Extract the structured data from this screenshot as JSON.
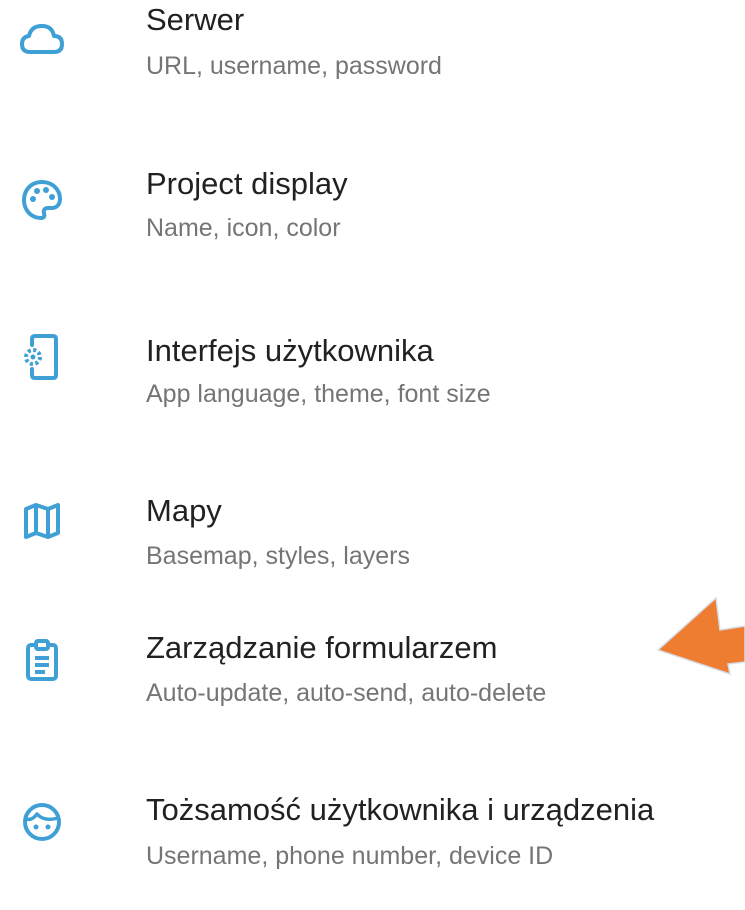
{
  "accent_color": "#3fa0d6",
  "annotation_color": "#ee7d31",
  "settings": [
    {
      "icon": "cloud-icon",
      "title": "Serwer",
      "subtitle": "URL, username, password"
    },
    {
      "icon": "palette-icon",
      "title": "Project display",
      "subtitle": "Name, icon, color"
    },
    {
      "icon": "phone-settings-icon",
      "title": "Interfejs użytkownika",
      "subtitle": "App language, theme, font size"
    },
    {
      "icon": "map-icon",
      "title": "Mapy",
      "subtitle": "Basemap, styles, layers"
    },
    {
      "icon": "clipboard-icon",
      "title": "Zarządzanie formularzem",
      "subtitle": "Auto-update, auto-send, auto-delete"
    },
    {
      "icon": "face-icon",
      "title": "Tożsamość użytkownika i urządzenia",
      "subtitle": "Username, phone number, device ID"
    }
  ]
}
